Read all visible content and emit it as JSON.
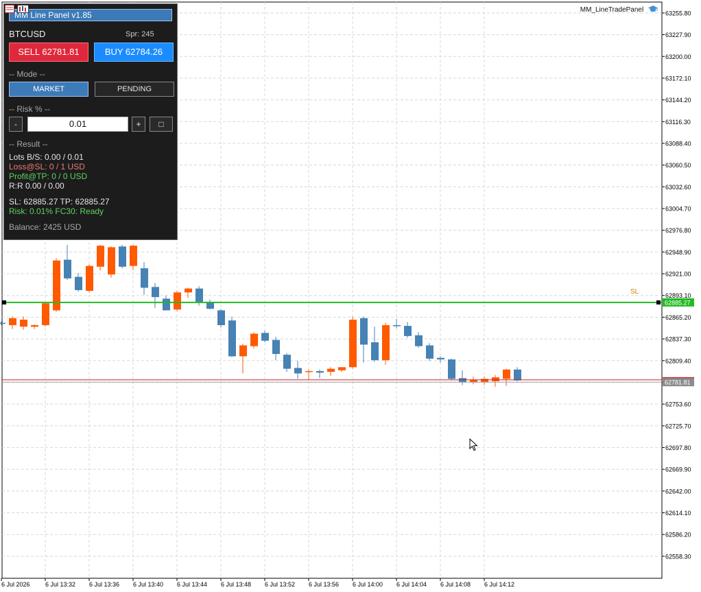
{
  "indicator_label": "MM_LineTradePanel",
  "panel": {
    "title": "MM Line Panel  v1.85",
    "symbol": "BTCUSD",
    "spread": "Spr: 245",
    "sell_label": "SELL  62781.81",
    "buy_label": "BUY  62784.26",
    "mode_header": "-- Mode --",
    "mode_market": "MARKET",
    "mode_pending": "PENDING",
    "risk_header": "-- Risk % --",
    "minus": "-",
    "risk_value": "0.01",
    "plus": "+",
    "square": "□",
    "result_header": "-- Result --",
    "lots": "Lots B/S: 0.00 / 0.01",
    "loss": "Loss@SL: 0 / 1 USD",
    "profit": "Profit@TP: 0 / 0 USD",
    "rr": "R:R  0.00 / 0.00",
    "sltp": "SL: 62885.27   TP: 62885.27",
    "risk_line": "Risk: 0.01%   FC30: Ready",
    "balance": "Balance: 2425 USD"
  },
  "colors": {
    "bull": "#ff5a00",
    "bear": "#4682b4",
    "line_green": "#22bb22",
    "line_red": "#cc2222",
    "price_label_grey": "#8c8c8c",
    "grid": "#d8d8d8"
  },
  "chart_data": {
    "type": "candlestick",
    "ylim": [
      62530.0,
      63269.8
    ],
    "y_ticks": [
      "63255.80",
      "63227.90",
      "63200.00",
      "63172.10",
      "63144.20",
      "63116.30",
      "63088.40",
      "63060.50",
      "63032.60",
      "63004.70",
      "62976.80",
      "62948.90",
      "62921.00",
      "62893.10",
      "62865.20",
      "62837.30",
      "62809.40",
      "62781.50",
      "62753.60",
      "62725.70",
      "62697.80",
      "62669.90",
      "62642.00",
      "62614.10",
      "62586.20",
      "62558.30"
    ],
    "x_ticks": [
      "6 Jul 2026",
      "6 Jul 13:32",
      "6 Jul 13:36",
      "6 Jul 13:40",
      "6 Jul 13:44",
      "6 Jul 13:48",
      "6 Jul 13:52",
      "6 Jul 13:56",
      "6 Jul 14:00",
      "6 Jul 14:04",
      "6 Jul 14:08",
      "6 Jul 14:12"
    ],
    "candles": [
      {
        "o": 62858,
        "h": 62860,
        "l": 62855,
        "c": 62857
      },
      {
        "o": 62855,
        "h": 62866,
        "l": 62850,
        "c": 62864
      },
      {
        "o": 62853,
        "h": 62866,
        "l": 62849,
        "c": 62862
      },
      {
        "o": 62853,
        "h": 62856,
        "l": 62850,
        "c": 62855
      },
      {
        "o": 62855,
        "h": 62884,
        "l": 62853,
        "c": 62883
      },
      {
        "o": 62874,
        "h": 62941,
        "l": 62872,
        "c": 62938
      },
      {
        "o": 62939,
        "h": 62958,
        "l": 62913,
        "c": 62915
      },
      {
        "o": 62917,
        "h": 62922,
        "l": 62898,
        "c": 62900
      },
      {
        "o": 62899,
        "h": 62933,
        "l": 62897,
        "c": 62931
      },
      {
        "o": 62930,
        "h": 62958,
        "l": 62925,
        "c": 62957
      },
      {
        "o": 62920,
        "h": 62956,
        "l": 62916,
        "c": 62955
      },
      {
        "o": 62956,
        "h": 62958,
        "l": 62928,
        "c": 62930
      },
      {
        "o": 62931,
        "h": 62958,
        "l": 62926,
        "c": 62957
      },
      {
        "o": 62928,
        "h": 62936,
        "l": 62894,
        "c": 62903
      },
      {
        "o": 62904,
        "h": 62909,
        "l": 62877,
        "c": 62891
      },
      {
        "o": 62889,
        "h": 62893,
        "l": 62876,
        "c": 62874
      },
      {
        "o": 62875,
        "h": 62899,
        "l": 62873,
        "c": 62897
      },
      {
        "o": 62897,
        "h": 62903,
        "l": 62890,
        "c": 62902
      },
      {
        "o": 62902,
        "h": 62905,
        "l": 62880,
        "c": 62885
      },
      {
        "o": 62885,
        "h": 62888,
        "l": 62875,
        "c": 62876
      },
      {
        "o": 62874,
        "h": 62876,
        "l": 62852,
        "c": 62855
      },
      {
        "o": 62861,
        "h": 62866,
        "l": 62814,
        "c": 62815
      },
      {
        "o": 62815,
        "h": 62831,
        "l": 62793,
        "c": 62829
      },
      {
        "o": 62828,
        "h": 62846,
        "l": 62825,
        "c": 62844
      },
      {
        "o": 62845,
        "h": 62848,
        "l": 62833,
        "c": 62835
      },
      {
        "o": 62836,
        "h": 62840,
        "l": 62810,
        "c": 62818
      },
      {
        "o": 62817,
        "h": 62819,
        "l": 62795,
        "c": 62799
      },
      {
        "o": 62800,
        "h": 62809,
        "l": 62786,
        "c": 62793
      },
      {
        "o": 62795,
        "h": 62798,
        "l": 62784,
        "c": 62796
      },
      {
        "o": 62796,
        "h": 62798,
        "l": 62787,
        "c": 62794
      },
      {
        "o": 62795,
        "h": 62801,
        "l": 62790,
        "c": 62799
      },
      {
        "o": 62797,
        "h": 62801,
        "l": 62795,
        "c": 62801
      },
      {
        "o": 62801,
        "h": 62866,
        "l": 62799,
        "c": 62862
      },
      {
        "o": 62864,
        "h": 62866,
        "l": 62807,
        "c": 62830
      },
      {
        "o": 62833,
        "h": 62853,
        "l": 62808,
        "c": 62810
      },
      {
        "o": 62810,
        "h": 62858,
        "l": 62804,
        "c": 62855
      },
      {
        "o": 62855,
        "h": 62863,
        "l": 62851,
        "c": 62854
      },
      {
        "o": 62854,
        "h": 62859,
        "l": 62839,
        "c": 62841
      },
      {
        "o": 62842,
        "h": 62846,
        "l": 62826,
        "c": 62828
      },
      {
        "o": 62829,
        "h": 62832,
        "l": 62809,
        "c": 62812
      },
      {
        "o": 62813,
        "h": 62815,
        "l": 62807,
        "c": 62811
      },
      {
        "o": 62811,
        "h": 62812,
        "l": 62784,
        "c": 62786
      },
      {
        "o": 62787,
        "h": 62797,
        "l": 62778,
        "c": 62782
      },
      {
        "o": 62782,
        "h": 62789,
        "l": 62779,
        "c": 62785
      },
      {
        "o": 62782,
        "h": 62789,
        "l": 62778,
        "c": 62786
      },
      {
        "o": 62783,
        "h": 62791,
        "l": 62776,
        "c": 62788
      },
      {
        "o": 62786,
        "h": 62799,
        "l": 62777,
        "c": 62798
      },
      {
        "o": 62798,
        "h": 62801,
        "l": 62783,
        "c": 62784
      }
    ],
    "lines": [
      {
        "value": 62884.2,
        "label": "62885.27",
        "kind": "sl-tp"
      },
      {
        "value": 62784.7,
        "label": "",
        "kind": "ask"
      },
      {
        "value": 62781.8,
        "label": "62781.81",
        "kind": "bid"
      }
    ],
    "annotation": "SL"
  }
}
